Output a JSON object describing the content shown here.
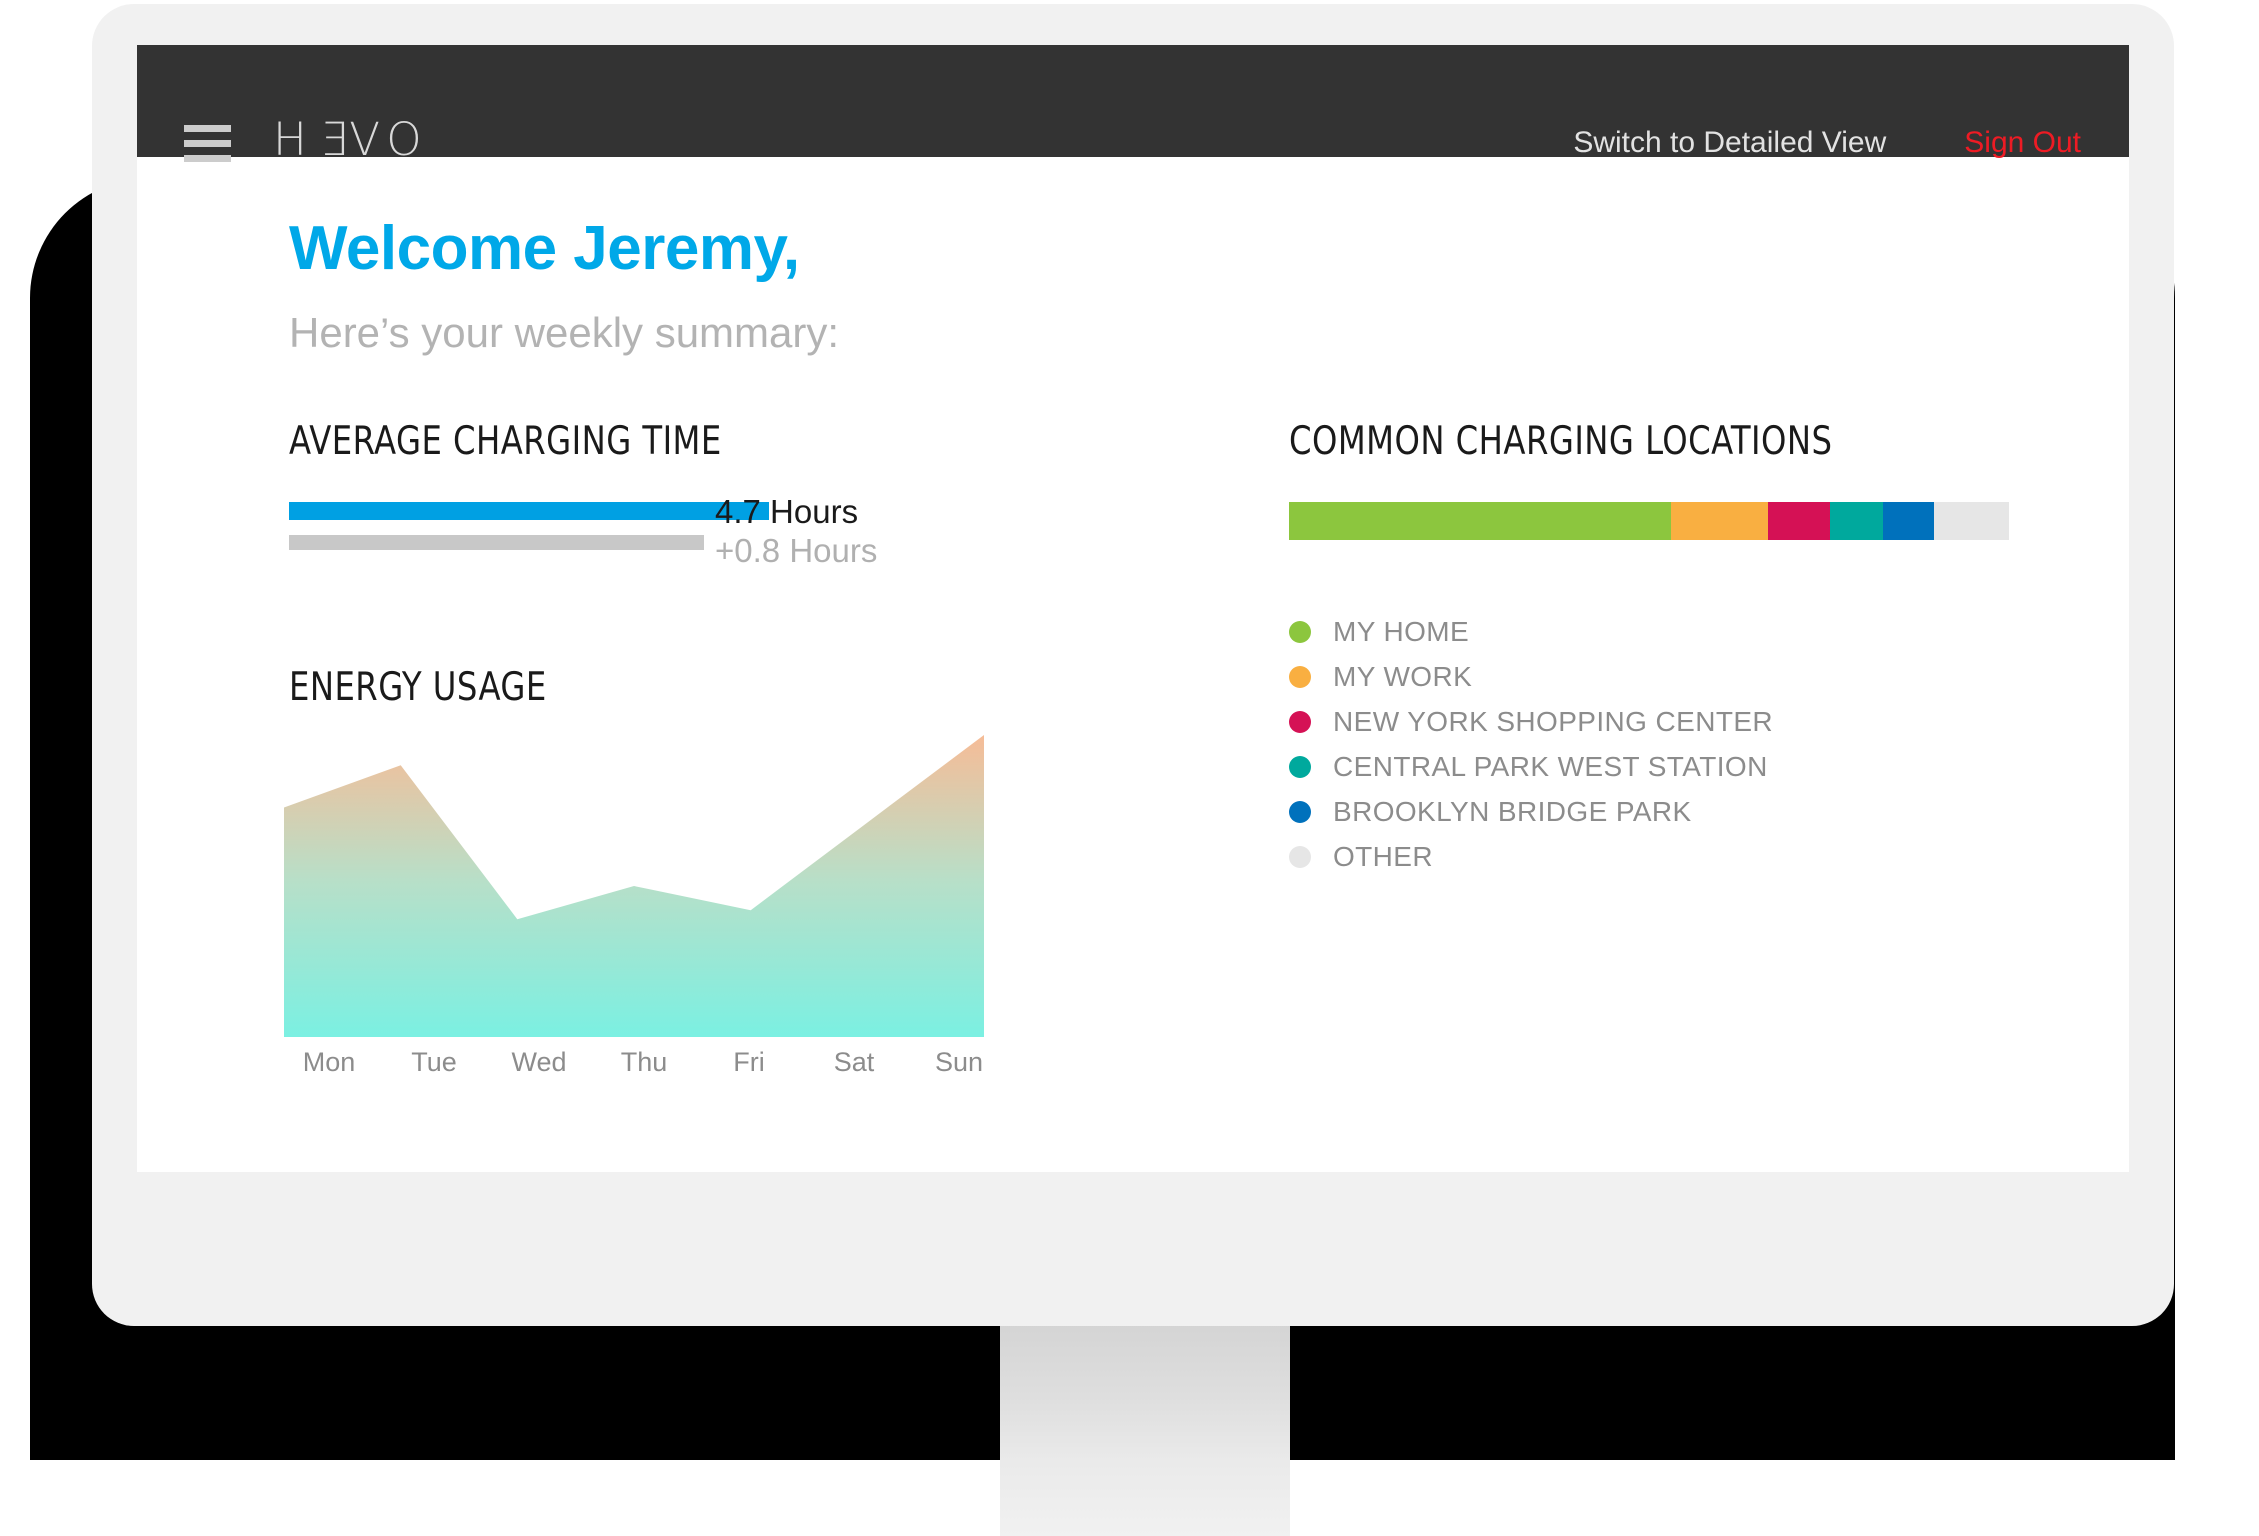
{
  "header": {
    "menu_icon": "hamburger-icon",
    "brand": "HEVO",
    "brand_parts": [
      "H",
      "E",
      "VO"
    ],
    "links": [
      {
        "label": "Switch to Detailed View",
        "style": "muted"
      },
      {
        "label": "Sign Out",
        "style": "danger"
      }
    ],
    "bg": "#333333",
    "danger_color": "#ee1b24"
  },
  "page": {
    "welcome": "Welcome Jeremy,",
    "subtitle": "Here’s your weekly summary:",
    "accent": "#00a8e8"
  },
  "avg_charging": {
    "title": "AVERAGE CHARGING TIME",
    "value": "4.7 Hours",
    "delta": "+0.8 Hours",
    "primary_color": "#00a0e3",
    "secondary_color": "#c8c8c8"
  },
  "energy_usage": {
    "title": "ENERGY USAGE"
  },
  "locations": {
    "title": "COMMON CHARGING LOCATIONS",
    "legend": [
      {
        "label": "MY HOME",
        "color": "#8cc63e",
        "percent": 53
      },
      {
        "label": "MY WORK",
        "color": "#f9af41",
        "percent": 13.5
      },
      {
        "label": "NEW YORK SHOPPING CENTER",
        "color": "#d51155",
        "percent": 8.7
      },
      {
        "label": "CENTRAL PARK WEST STATION",
        "color": "#00a99d",
        "percent": 7.3
      },
      {
        "label": "BROOKLYN BRIDGE PARK",
        "color": "#0071bc",
        "percent": 7.1
      },
      {
        "label": "OTHER",
        "color": "#e6e6e6",
        "percent": 10.4
      }
    ]
  },
  "chart_data": {
    "type": "area",
    "title": "ENERGY USAGE",
    "xlabel": "",
    "ylabel": "",
    "categories": [
      "Mon",
      "Tue",
      "Wed",
      "Thu",
      "Fri",
      "Sat",
      "Sun"
    ],
    "values": [
      76,
      90,
      39,
      50,
      42,
      71,
      100
    ],
    "ylim": [
      0,
      100
    ],
    "grid": false,
    "legend": "none",
    "fill_gradient_top": "#f6c4a1",
    "fill_gradient_bottom": "#7defe0"
  }
}
